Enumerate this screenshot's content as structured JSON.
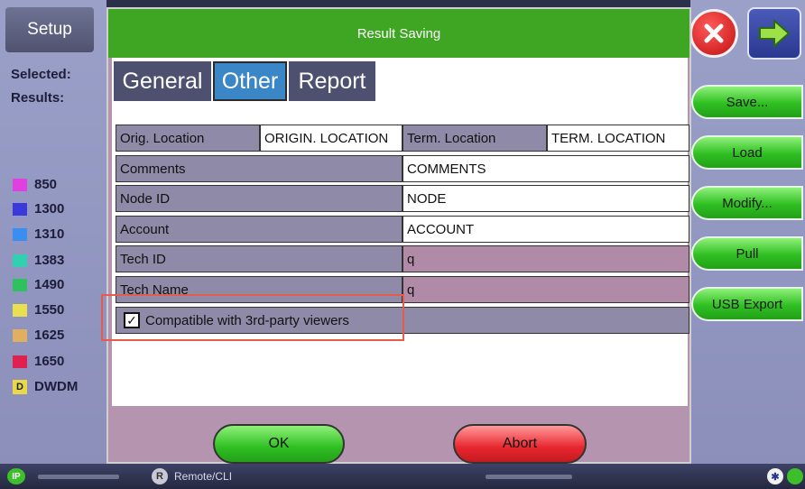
{
  "left": {
    "setup_label": "Setup",
    "selected_label": "Selected:",
    "results_label": "Results:",
    "wavelengths": [
      {
        "label": "850",
        "color": "#e040e0"
      },
      {
        "label": "1300",
        "color": "#3a3ad8"
      },
      {
        "label": "1310",
        "color": "#3a8ef0"
      },
      {
        "label": "1383",
        "color": "#30d0b0"
      },
      {
        "label": "1490",
        "color": "#30c060"
      },
      {
        "label": "1550",
        "color": "#e8e050"
      },
      {
        "label": "1625",
        "color": "#e0b060"
      },
      {
        "label": "1650",
        "color": "#e02050"
      },
      {
        "label": "DWDM",
        "badge": "D",
        "color": "#e8d84a"
      }
    ]
  },
  "dialog": {
    "title": "Result Saving",
    "tabs": [
      {
        "label": "General",
        "active": false
      },
      {
        "label": "Other",
        "active": true
      },
      {
        "label": "Report",
        "active": false
      }
    ],
    "orig_location_label": "Orig. Location",
    "orig_location_value": "ORIGIN. LOCATION",
    "term_location_label": "Term. Location",
    "term_location_value": "TERM. LOCATION",
    "rows": [
      {
        "label": "Comments",
        "value": "COMMENTS"
      },
      {
        "label": "Node ID",
        "value": "NODE"
      },
      {
        "label": "Account",
        "value": "ACCOUNT"
      },
      {
        "label": "Tech ID",
        "value": "q"
      },
      {
        "label": "Tech Name",
        "value": "q"
      }
    ],
    "compat": {
      "label": "Compatible with 3rd-party viewers",
      "checked": true
    },
    "ok_label": "OK",
    "abort_label": "Abort"
  },
  "right": {
    "buttons": [
      "Save...",
      "Load",
      "Modify...",
      "Pull",
      "USB Export"
    ]
  },
  "status": {
    "ip_label": "IP",
    "remote_badge": "R",
    "remote_label": "Remote/CLI",
    "bt_glyph": "✱"
  },
  "icons": {
    "close": "close-icon",
    "next": "arrow-right-icon",
    "bluetooth": "bluetooth-icon"
  }
}
